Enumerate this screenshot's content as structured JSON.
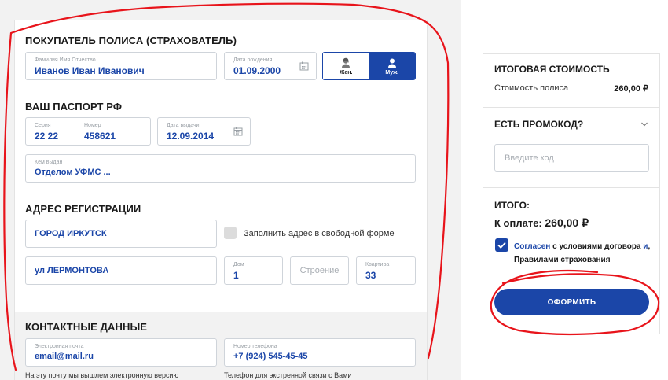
{
  "policyholder": {
    "section_title": "ПОКУПАТЕЛЬ ПОЛИСА (СТРАХОВАТЕЛЬ)",
    "fullname_label": "Фамилия Имя Отчество",
    "fullname_value": "Иванов Иван Иванович",
    "birthdate_label": "Дата рождения",
    "birthdate_value": "01.09.2000",
    "gender_female": "Жен.",
    "gender_male": "Муж.",
    "gender_selected": "Муж."
  },
  "passport": {
    "section_title": "ВАШ ПАСПОРТ РФ",
    "series_label": "Серия",
    "series_value": "22 22",
    "number_label": "Номер",
    "number_value": "458621",
    "issue_date_label": "Дата выдачи",
    "issue_date_value": "12.09.2014",
    "issued_by_label": "Кем выдан",
    "issued_by_value": "Отделом УФМС ..."
  },
  "address": {
    "section_title": "АДРЕС РЕГИСТРАЦИИ",
    "city_value": "ГОРОД ИРКУТСК",
    "freeform_checkbox_label": "Заполнить адрес в свободной форме",
    "street_value": "ул ЛЕРМОНТОВА",
    "house_label": "Дом",
    "house_value": "1",
    "building_placeholder": "Строение",
    "apartment_label": "Квартира",
    "apartment_value": "33"
  },
  "contacts": {
    "section_title": "КОНТАКТНЫЕ ДАННЫЕ",
    "email_label": "Электронная почта",
    "email_value": "email@mail.ru",
    "phone_label": "Номер телефона",
    "phone_value": "+7 (924) 545-45-45",
    "email_note": "На эту почту мы вышлем электронную версию",
    "phone_note": "Телефон для экстренной связи с Вами"
  },
  "summary": {
    "title": "ИТОГОВАЯ СТОИМОСТЬ",
    "policy_cost_label": "Стоимость полиса",
    "policy_cost_value": "260,00 ₽",
    "promo_title": "ЕСТЬ ПРОМОКОД?",
    "promo_placeholder": "Введите код",
    "total_title": "ИТОГО:",
    "pay_label": "К оплате:",
    "pay_value": "260,00 ₽",
    "agree_link1": "Согласен",
    "agree_text1": " с условиями договора ",
    "agree_link2": "и",
    "agree_text2": ", Правилами страхования",
    "agree_checked": true,
    "order_button": "ОФОРМИТЬ"
  },
  "colors": {
    "accent": "#1b46a8",
    "annotation": "#e8141b"
  },
  "icons": [
    "calendar-icon",
    "female-avatar-icon",
    "male-avatar-icon",
    "chevron-down-icon",
    "checkmark-icon"
  ]
}
